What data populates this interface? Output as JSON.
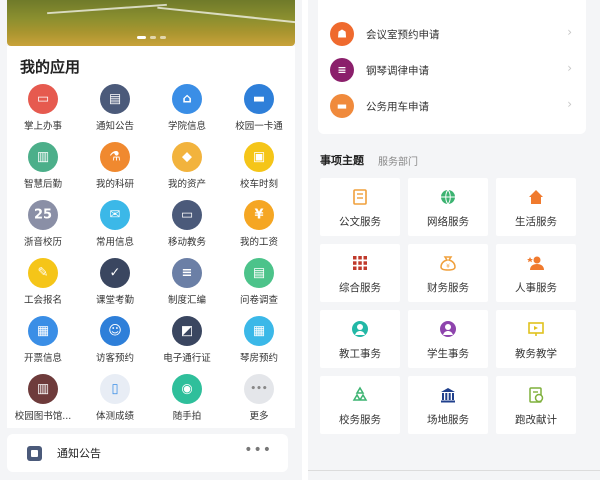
{
  "my_apps": {
    "title": "我的应用",
    "items": [
      {
        "label": "掌上办事",
        "icon": "briefcase-icon",
        "color": "#e65a4f",
        "glyph": "▭"
      },
      {
        "label": "通知公告",
        "icon": "notice-icon",
        "color": "#4b5a7a",
        "glyph": "▤"
      },
      {
        "label": "学院信息",
        "icon": "college-icon",
        "color": "#3a8ee6",
        "glyph": "⌂"
      },
      {
        "label": "校园一卡通",
        "icon": "card-icon",
        "color": "#2e7fd9",
        "glyph": "▬"
      },
      {
        "label": "智慧后勤",
        "icon": "logistics-icon",
        "color": "#4caf8a",
        "glyph": "▥"
      },
      {
        "label": "我的科研",
        "icon": "microscope-icon",
        "color": "#f0892f",
        "glyph": "⚗"
      },
      {
        "label": "我的资产",
        "icon": "assets-icon",
        "color": "#f2b33d",
        "glyph": "◆"
      },
      {
        "label": "校车时刻",
        "icon": "bus-icon",
        "color": "#f5c518",
        "glyph": "▣"
      },
      {
        "label": "浙音校历",
        "icon": "calendar-icon",
        "color": "#8a8fa6",
        "glyph": "25"
      },
      {
        "label": "常用信息",
        "icon": "mail-icon",
        "color": "#3bb8e8",
        "glyph": "✉"
      },
      {
        "label": "移动教务",
        "icon": "blackboard-icon",
        "color": "#4b5a7a",
        "glyph": "▭"
      },
      {
        "label": "我的工资",
        "icon": "salary-icon",
        "color": "#f5a623",
        "glyph": "¥"
      },
      {
        "label": "工会报名",
        "icon": "union-icon",
        "color": "#f5c518",
        "glyph": "✎"
      },
      {
        "label": "课堂考勤",
        "icon": "attendance-icon",
        "color": "#3a4660",
        "glyph": "✓"
      },
      {
        "label": "制度汇编",
        "icon": "document-icon",
        "color": "#6b7fa6",
        "glyph": "≡"
      },
      {
        "label": "问卷调查",
        "icon": "survey-icon",
        "color": "#4cc38a",
        "glyph": "▤"
      },
      {
        "label": "开票信息",
        "icon": "invoice-icon",
        "color": "#3a8ee6",
        "glyph": "▦"
      },
      {
        "label": "访客预约",
        "icon": "visitor-icon",
        "color": "#2e7fd9",
        "glyph": "☺"
      },
      {
        "label": "电子通行证",
        "icon": "pass-icon",
        "color": "#3a4660",
        "glyph": "◩"
      },
      {
        "label": "琴房预约",
        "icon": "piano-room-icon",
        "color": "#3bb8e8",
        "glyph": "▦"
      },
      {
        "label": "校园图书馆...",
        "icon": "library-icon",
        "color": "#6e3b3b",
        "glyph": "▥"
      },
      {
        "label": "体测成绩",
        "icon": "fitness-icon",
        "color": "#e8edf5",
        "glyph": "▯"
      },
      {
        "label": "随手拍",
        "icon": "camera-icon",
        "color": "#2fbf9b",
        "glyph": "◉"
      },
      {
        "label": "更多",
        "icon": "more-icon",
        "color": "#e4e6ea",
        "glyph": "•••"
      }
    ]
  },
  "notice": {
    "title": "通知公告",
    "more": "•••"
  },
  "requests": [
    {
      "label": "会议室预约申请",
      "icon": "meeting-room-icon",
      "color": "#ef6a2e",
      "glyph": "☗"
    },
    {
      "label": "钢琴调律申请",
      "icon": "piano-tuning-icon",
      "color": "#8b1f6b",
      "glyph": "≡"
    },
    {
      "label": "公务用车申请",
      "icon": "car-icon",
      "color": "#f08a3c",
      "glyph": "▬"
    }
  ],
  "tabs": {
    "active": "事项主题",
    "other": "服务部门"
  },
  "services": [
    {
      "label": "公文服务",
      "icon": "official-doc-icon",
      "color": "#f0a03c"
    },
    {
      "label": "网络服务",
      "icon": "network-icon",
      "color": "#3cb371"
    },
    {
      "label": "生活服务",
      "icon": "home-icon",
      "color": "#f07a2e"
    },
    {
      "label": "综合服务",
      "icon": "grid-icon",
      "color": "#c0392b"
    },
    {
      "label": "财务服务",
      "icon": "money-bag-icon",
      "color": "#f0a03c"
    },
    {
      "label": "人事服务",
      "icon": "person-icon",
      "color": "#f07a2e"
    },
    {
      "label": "教工事务",
      "icon": "staff-icon",
      "color": "#22b8a6"
    },
    {
      "label": "学生事务",
      "icon": "student-icon",
      "color": "#8e44ad"
    },
    {
      "label": "教务教学",
      "icon": "teaching-icon",
      "color": "#e0c21e"
    },
    {
      "label": "校务服务",
      "icon": "recycle-icon",
      "color": "#3cb371"
    },
    {
      "label": "场地服务",
      "icon": "venue-icon",
      "color": "#1f3f8c"
    },
    {
      "label": "跑改献计",
      "icon": "suggestion-icon",
      "color": "#7fb03c"
    }
  ]
}
